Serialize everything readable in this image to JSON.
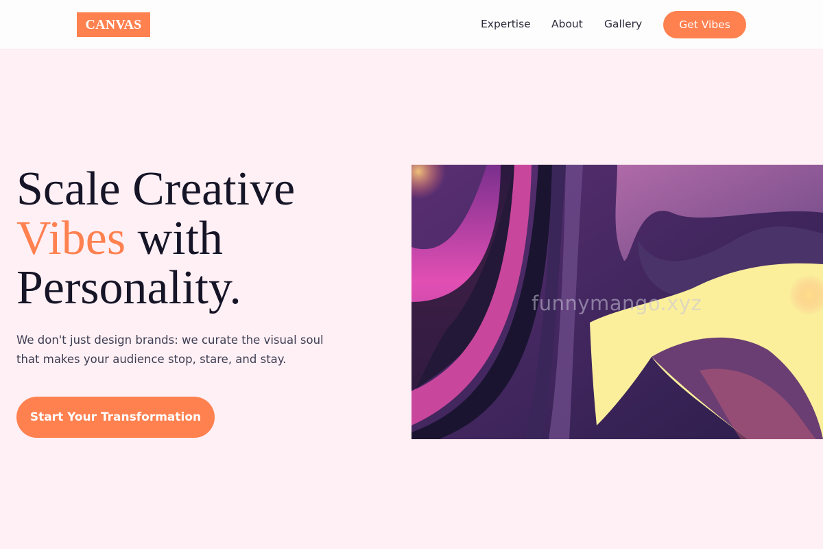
{
  "navbar": {
    "logo": "CANVAS",
    "links": [
      "Expertise",
      "About",
      "Gallery"
    ],
    "cta": "Get Vibes"
  },
  "hero": {
    "headline": {
      "line1": "Scale Creative",
      "accent": "Vibes",
      "line2_rest": " with",
      "line3": "Personality."
    },
    "subtext": "We don't just design brands: we curate the visual soul that makes your audience stop, stare, and stay.",
    "cta": "Start Your Transformation",
    "image_watermark": "funnymango.xyz"
  },
  "colors": {
    "accent": "#ff8150",
    "background": "#fff0f5",
    "heading": "#161527",
    "body_text": "#3d3d52",
    "nav_background": "#fefdfe"
  }
}
